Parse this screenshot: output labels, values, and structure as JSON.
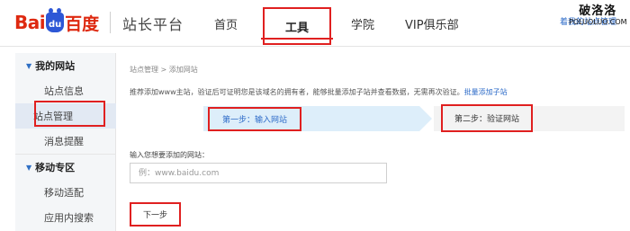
{
  "header": {
    "logo": {
      "part1": "Bai",
      "paw": "du",
      "part2": "百度"
    },
    "site_title": "站长平台",
    "nav": {
      "home": "首页",
      "tools": "工具",
      "school": "学院",
      "vip": "VIP俱乐部"
    },
    "right_link": "着我的站点管理",
    "watermark": {
      "cn": "破洛洛",
      "en": "POLUOLUO.COM"
    }
  },
  "sidebar": {
    "groups": [
      {
        "label": "我的网站",
        "items": [
          "站点信息",
          "站点管理",
          "消息提醒"
        ]
      },
      {
        "label": "移动专区",
        "items": [
          "移动适配",
          "应用内搜索"
        ]
      }
    ],
    "active_item": "站点管理"
  },
  "main": {
    "breadcrumb": "站点管理 > 添加网站",
    "intro_text": "推荐添加www主站，验证后可证明您是该域名的拥有者，能够批量添加子站并查看数据，无需再次验证。",
    "intro_link": "批量添加子站",
    "steps": [
      "第一步：输入网站",
      "第二步：验证网站"
    ],
    "field_label": "输入您想要添加的网站：",
    "input_placeholder": "例：www.baidu.com",
    "next_button": "下一步"
  },
  "colors": {
    "highlight_red": "#e02020",
    "link_blue": "#2d6bc8",
    "baidu_red": "#de2910",
    "baidu_blue": "#2d57d6"
  }
}
